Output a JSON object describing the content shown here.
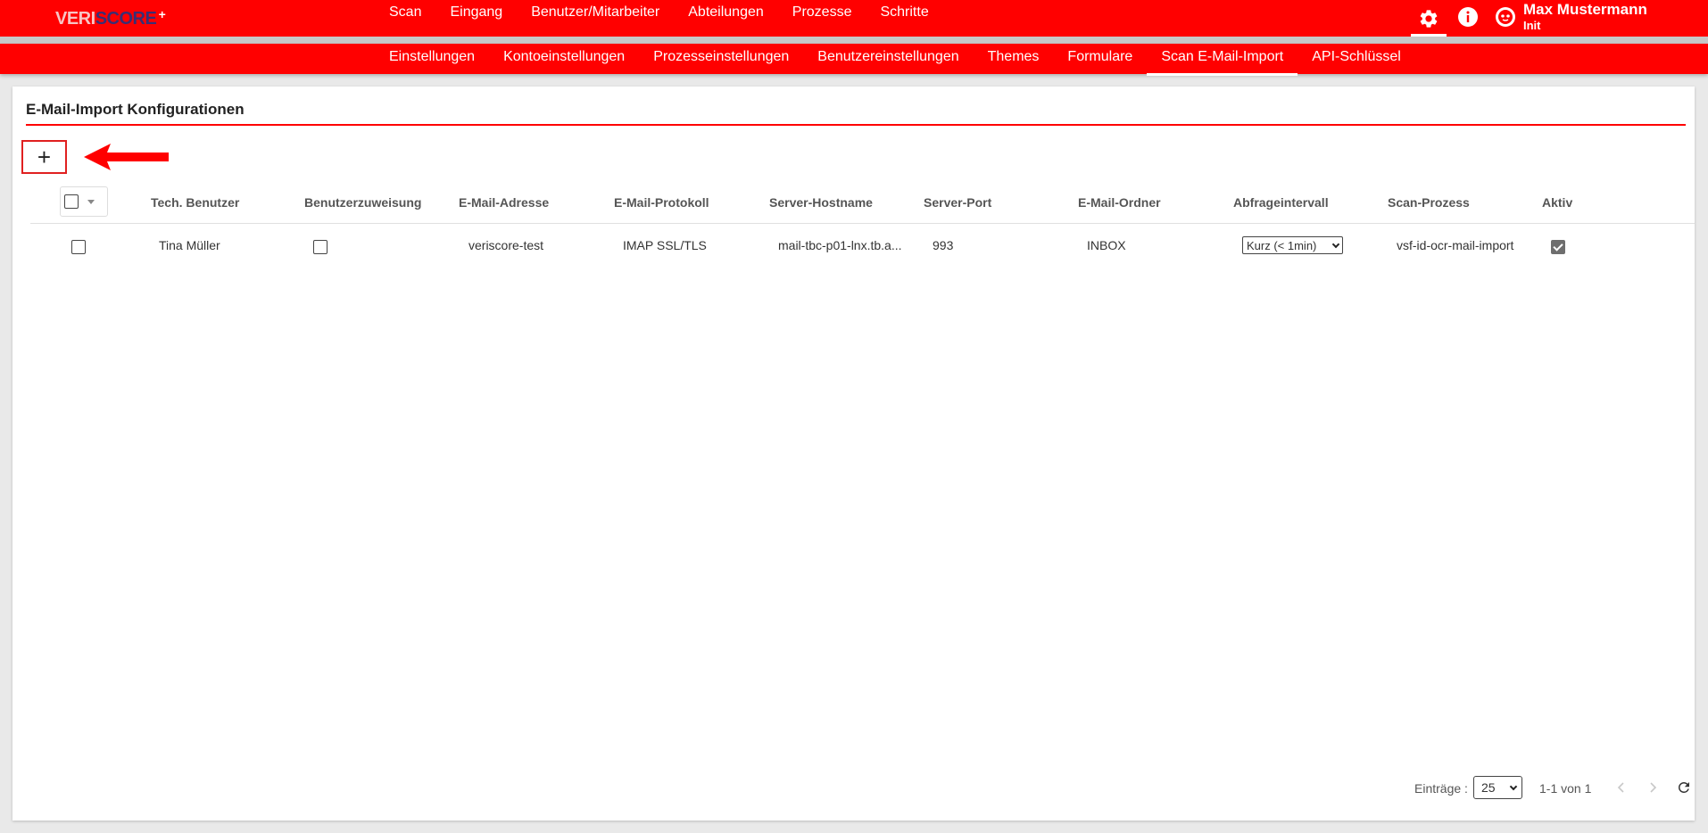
{
  "app": {
    "logo_part1": "VERI",
    "logo_part2": "SCORE",
    "logo_plus": "+"
  },
  "main_nav": [
    {
      "label": "Scan"
    },
    {
      "label": "Eingang"
    },
    {
      "label": "Benutzer/Mitarbeiter"
    },
    {
      "label": "Abteilungen"
    },
    {
      "label": "Prozesse"
    },
    {
      "label": "Schritte"
    }
  ],
  "header_icons": [
    "gear-icon",
    "info-icon",
    "avatar-icon"
  ],
  "user": {
    "name": "Max Mustermann",
    "subtitle": "Init"
  },
  "sub_nav": [
    {
      "label": "Einstellungen"
    },
    {
      "label": "Kontoeinstellungen"
    },
    {
      "label": "Prozesseinstellungen"
    },
    {
      "label": "Benutzereinstellungen"
    },
    {
      "label": "Themes"
    },
    {
      "label": "Formulare"
    },
    {
      "label": "Scan E-Mail-Import",
      "active": true
    },
    {
      "label": "API-Schlüssel"
    }
  ],
  "page": {
    "title": "E-Mail-Import Konfigurationen",
    "add_label": "+"
  },
  "table": {
    "headers": {
      "tech_user": "Tech. Benutzer",
      "user_assignment": "Benutzerzuweisung",
      "email": "E-Mail-Adresse",
      "protocol": "E-Mail-Protokoll",
      "hostname": "Server-Hostname",
      "port": "Server-Port",
      "folder": "E-Mail-Ordner",
      "interval": "Abfrageintervall",
      "process": "Scan-Prozess",
      "active": "Aktiv"
    },
    "rows": [
      {
        "selected": false,
        "tech_user": "Tina Müller",
        "user_assignment": false,
        "email": "veriscore-test",
        "protocol": "IMAP SSL/TLS",
        "hostname": "mail-tbc-p01-lnx.tb.a...",
        "port": "993",
        "folder": "INBOX",
        "interval": "Kurz (< 1min)",
        "process": "vsf-id-ocr-mail-import",
        "active": true
      }
    ]
  },
  "pagination": {
    "entries_label": "Einträge :",
    "page_size": "25",
    "range": "1-1 von 1"
  },
  "colors": {
    "brand_red": "#ff0000",
    "logo_dark": "#3a2e74"
  }
}
